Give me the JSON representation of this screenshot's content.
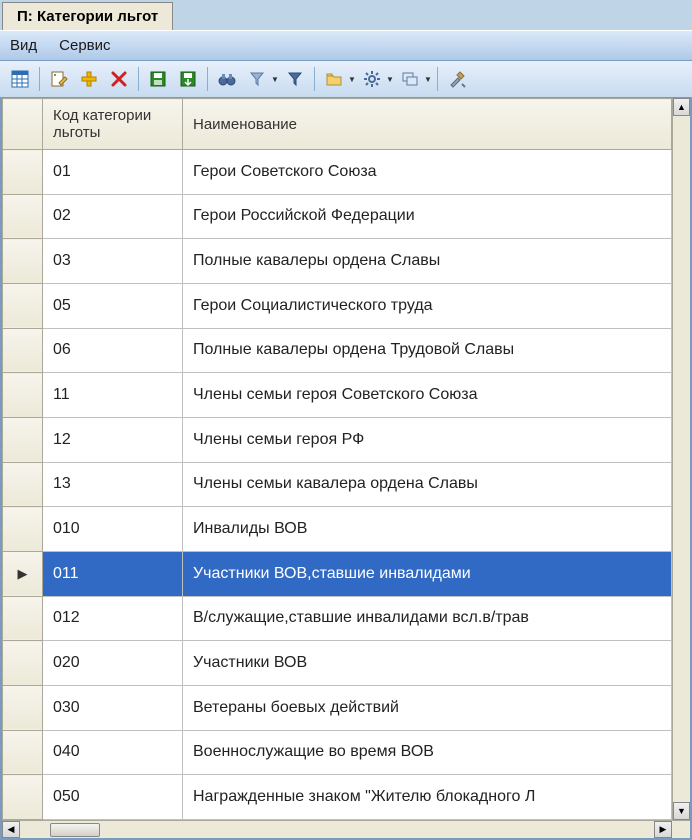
{
  "window": {
    "tab_title": "П: Категории льгот"
  },
  "menu": {
    "view": "Вид",
    "service": "Сервис"
  },
  "table": {
    "headers": {
      "code": "Код категории льготы",
      "name": "Наименование"
    },
    "rows": [
      {
        "code": "01",
        "name": "Герои Советского Союза",
        "selected": false
      },
      {
        "code": "02",
        "name": "Герои Российской Федерации",
        "selected": false
      },
      {
        "code": "03",
        "name": "Полные кавалеры ордена Славы",
        "selected": false
      },
      {
        "code": "05",
        "name": "Герои Социалистического труда",
        "selected": false
      },
      {
        "code": "06",
        "name": "Полные кавалеры ордена Трудовой Славы",
        "selected": false
      },
      {
        "code": "11",
        "name": "Члены семьи героя Советского Союза",
        "selected": false
      },
      {
        "code": "12",
        "name": "Члены семьи героя РФ",
        "selected": false
      },
      {
        "code": "13",
        "name": "Члены семьи кавалера ордена Славы",
        "selected": false
      },
      {
        "code": "010",
        "name": "Инвалиды ВОВ",
        "selected": false
      },
      {
        "code": "011",
        "name": "Участники ВОВ,ставшие инвалидами",
        "selected": true
      },
      {
        "code": "012",
        "name": "В/служащие,ставшие инвалидами  всл.в/трав",
        "selected": false
      },
      {
        "code": "020",
        "name": "Участники ВОВ",
        "selected": false
      },
      {
        "code": "030",
        "name": "Ветераны боевых действий",
        "selected": false
      },
      {
        "code": "040",
        "name": "Военнослужащие во время ВОВ",
        "selected": false
      },
      {
        "code": "050",
        "name": "Награжденные знаком \"Жителю блокадного Л",
        "selected": false
      }
    ]
  }
}
